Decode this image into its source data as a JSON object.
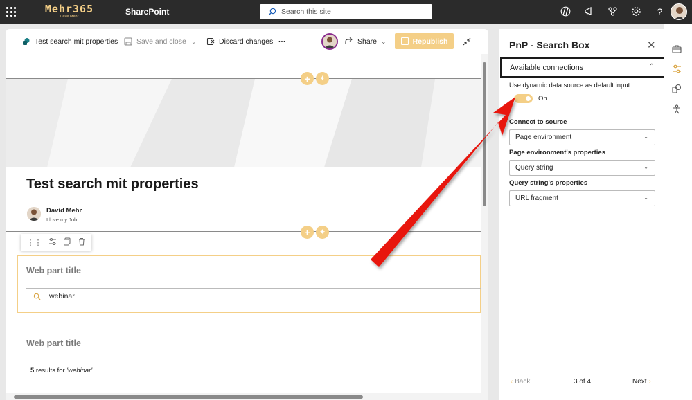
{
  "suitebar": {
    "logo_main": "Mehr365",
    "logo_sub": "Dave Mehr",
    "app_name": "SharePoint",
    "search_placeholder": "Search this site",
    "icons": [
      "copilot-icon",
      "megaphone-icon",
      "share-network-icon",
      "settings-gear-icon",
      "help-icon"
    ]
  },
  "commandbar": {
    "page_name": "Test search mit properties",
    "save_close": "Save and close",
    "discard": "Discard changes",
    "more": "···",
    "share": "Share",
    "republish": "Republish"
  },
  "page": {
    "title": "Test search mit properties",
    "author_name": "David Mehr",
    "author_role": "I love my Job"
  },
  "webpart1": {
    "title": "Web part title",
    "search_value": "webinar"
  },
  "webpart2": {
    "title": "Web part title",
    "results_count": "5",
    "results_text": " results for ",
    "results_query": "'webinar'"
  },
  "pane": {
    "title": "PnP - Search Box",
    "section": "Available connections",
    "toggle_label": "Use dynamic data source as default input",
    "toggle_state": "On",
    "toggle_on": true,
    "connect_label": "Connect to source",
    "connect_value": "Page environment",
    "env_label": "Page environment's properties",
    "env_value": "Query string",
    "qs_label": "Query string's properties",
    "qs_value": "URL fragment",
    "back": "Back",
    "step": "3 of 4",
    "next": "Next"
  },
  "colors": {
    "accent": "#f4cf87",
    "suitebar": "#2b2b2b",
    "arrow": "#e8140f"
  }
}
